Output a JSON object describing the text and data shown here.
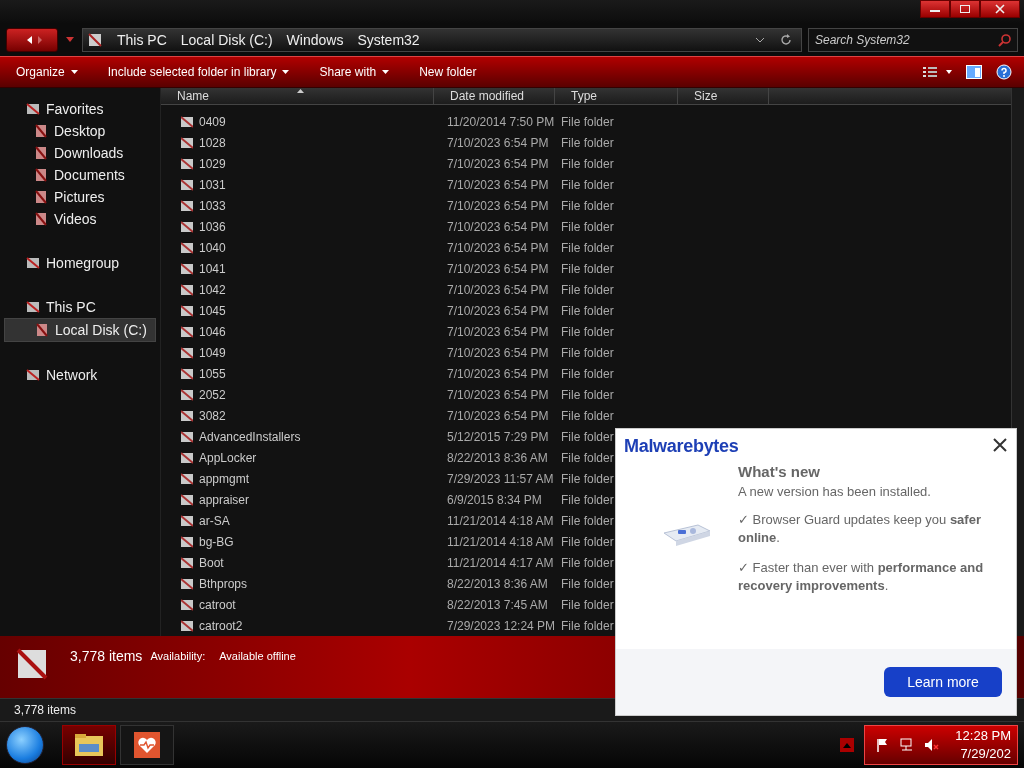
{
  "address": {
    "path": [
      "This PC",
      "Local Disk (C:)",
      "Windows",
      "System32"
    ]
  },
  "search": {
    "placeholder": "Search System32"
  },
  "toolbar": {
    "items": [
      {
        "label": "Organize",
        "dropdown": true
      },
      {
        "label": "Include selected folder in library",
        "dropdown": true
      },
      {
        "label": "Share with",
        "dropdown": true
      },
      {
        "label": "New folder",
        "dropdown": false
      }
    ]
  },
  "sidebar": {
    "groups": [
      {
        "label": "Favorites",
        "selected": false,
        "children": [
          {
            "label": "Desktop",
            "selected": false
          },
          {
            "label": "Downloads",
            "selected": false
          },
          {
            "label": "Documents",
            "selected": false
          },
          {
            "label": "Pictures",
            "selected": false
          },
          {
            "label": "Videos",
            "selected": false
          }
        ]
      },
      {
        "label": "Homegroup",
        "selected": false
      },
      {
        "label": "This PC",
        "selected": false,
        "children": [
          {
            "label": "Local Disk (C:)",
            "selected": true
          }
        ]
      },
      {
        "label": "Network",
        "selected": false
      }
    ]
  },
  "table": {
    "columns": [
      {
        "label": "Name",
        "sorted": true
      },
      {
        "label": "Date modified",
        "sorted": false
      },
      {
        "label": "Type",
        "sorted": false
      },
      {
        "label": "Size",
        "sorted": false
      }
    ],
    "rows": [
      [
        "0409",
        "11/20/2014 7:50 PM",
        "File folder"
      ],
      [
        "1028",
        "7/10/2023 6:54 PM",
        "File folder"
      ],
      [
        "1029",
        "7/10/2023 6:54 PM",
        "File folder"
      ],
      [
        "1031",
        "7/10/2023 6:54 PM",
        "File folder"
      ],
      [
        "1033",
        "7/10/2023 6:54 PM",
        "File folder"
      ],
      [
        "1036",
        "7/10/2023 6:54 PM",
        "File folder"
      ],
      [
        "1040",
        "7/10/2023 6:54 PM",
        "File folder"
      ],
      [
        "1041",
        "7/10/2023 6:54 PM",
        "File folder"
      ],
      [
        "1042",
        "7/10/2023 6:54 PM",
        "File folder"
      ],
      [
        "1045",
        "7/10/2023 6:54 PM",
        "File folder"
      ],
      [
        "1046",
        "7/10/2023 6:54 PM",
        "File folder"
      ],
      [
        "1049",
        "7/10/2023 6:54 PM",
        "File folder"
      ],
      [
        "1055",
        "7/10/2023 6:54 PM",
        "File folder"
      ],
      [
        "2052",
        "7/10/2023 6:54 PM",
        "File folder"
      ],
      [
        "3082",
        "7/10/2023 6:54 PM",
        "File folder"
      ],
      [
        "AdvancedInstallers",
        "5/12/2015 7:29 PM",
        "File folder"
      ],
      [
        "AppLocker",
        "8/22/2013 8:36 AM",
        "File folder"
      ],
      [
        "appmgmt",
        "7/29/2023 11:57 AM",
        "File folder"
      ],
      [
        "appraiser",
        "6/9/2015 8:34 PM",
        "File folder"
      ],
      [
        "ar-SA",
        "11/21/2014 4:18 AM",
        "File folder"
      ],
      [
        "bg-BG",
        "11/21/2014 4:18 AM",
        "File folder"
      ],
      [
        "Boot",
        "11/21/2014 4:17 AM",
        "File folder"
      ],
      [
        "Bthprops",
        "8/22/2013 8:36 AM",
        "File folder"
      ],
      [
        "catroot",
        "8/22/2013 7:45 AM",
        "File folder"
      ],
      [
        "catroot2",
        "7/29/2023 12:24 PM",
        "File folder"
      ]
    ]
  },
  "details": {
    "count": "3,778 items",
    "label": "Availability:",
    "value": "Available offline"
  },
  "status_bar": {
    "text": "3,778 items"
  },
  "popup": {
    "logo": "Malwarebytes",
    "title": "What's new",
    "subtitle": "A new version has been installed.",
    "bullets": [
      "✓ Browser Guard updates keep you **safer online**.",
      "✓ Faster than ever with **performance and recovery improvements**."
    ],
    "button": "Learn more"
  },
  "taskbar": {
    "time": "12:28 PM",
    "date": "7/29/202"
  }
}
